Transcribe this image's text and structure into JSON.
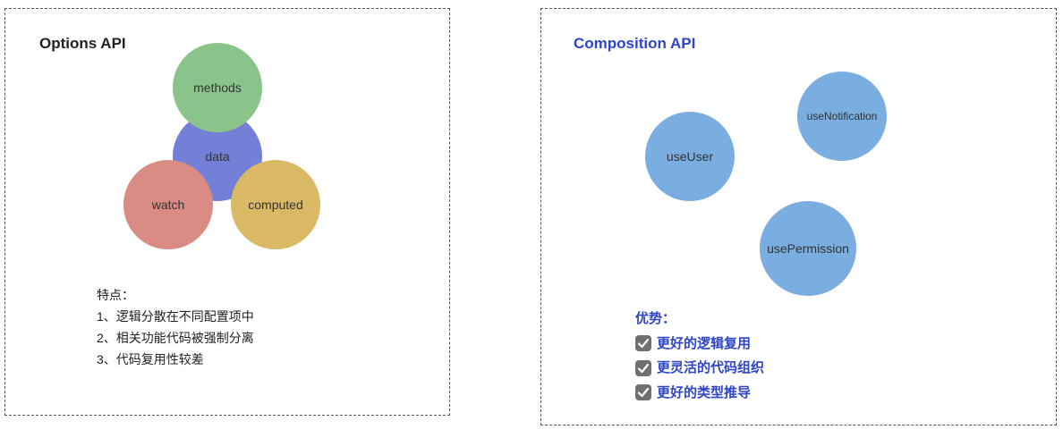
{
  "colors": {
    "border": "#555555",
    "right_accent": "#2f45c8",
    "methods": "#8bc48a",
    "data": "#7480d8",
    "watch": "#d98b84",
    "computed": "#d9b965",
    "composable": "#7aade0",
    "check_bg": "#707070"
  },
  "left": {
    "title": "Options API",
    "circles": {
      "methods": "methods",
      "data": "data",
      "watch": "watch",
      "computed": "computed"
    },
    "notes": {
      "heading": "特点：",
      "items": [
        "1、逻辑分散在不同配置项中",
        "2、相关功能代码被强制分离",
        "3、代码复用性较差"
      ]
    }
  },
  "right": {
    "title": "Composition API",
    "circles": {
      "use_user": "useUser",
      "use_notification": "useNotification",
      "use_permission": "usePermission"
    },
    "advantages": {
      "heading": "优势：",
      "items": [
        "更好的逻辑复用",
        "更灵活的代码组织",
        "更好的类型推导"
      ],
      "item_icon": "check-box-icon"
    }
  }
}
